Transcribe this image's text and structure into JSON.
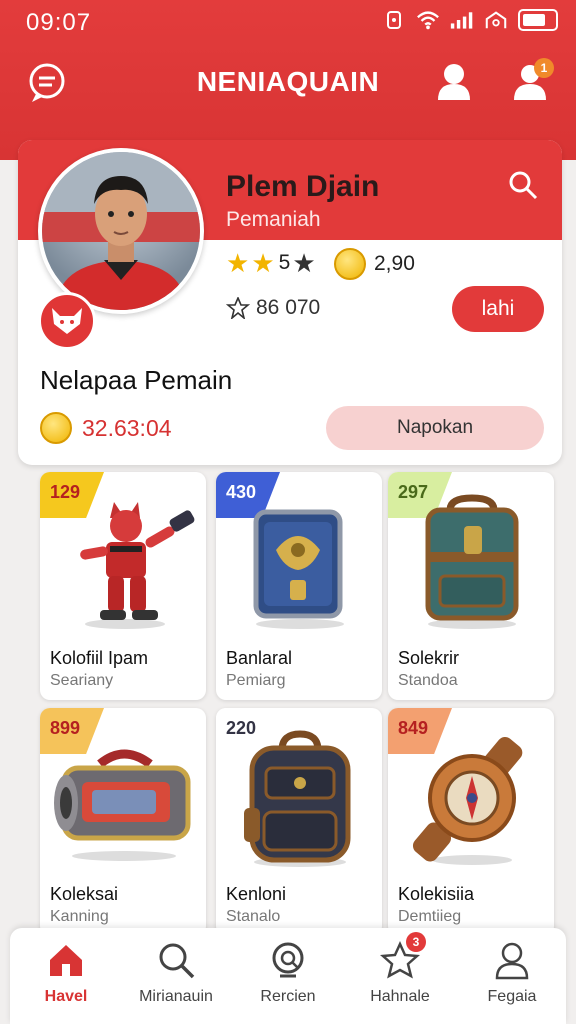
{
  "status_bar": {
    "time": "09:07"
  },
  "app_bar": {
    "title": "NENIAQUAIN",
    "profile_badge": "1"
  },
  "profile": {
    "name": "Plem Djain",
    "subtitle": "Pemaniah",
    "rating_text": "5",
    "coins": "2,90",
    "trophy_count": "86 070",
    "action_label": "lahi",
    "section_title": "Nelapaa Pemain",
    "balance": "32.63:04",
    "secondary_action_label": "Napokan"
  },
  "items": [
    {
      "tag": "129",
      "tag_color": "#f5c81e",
      "name": "Kolofiil Ipam",
      "sub": "Seariany",
      "icon": "mascot-figure-icon"
    },
    {
      "tag": "430",
      "tag_color": "#3f5fd6",
      "name": "Banlaral",
      "sub": "Pemiarg",
      "icon": "treasure-chest-icon"
    },
    {
      "tag": "297",
      "tag_color": "#d8eea0",
      "name": "Solekrir",
      "sub": "Standoa",
      "icon": "backpack-chest-icon"
    },
    {
      "tag": "899",
      "tag_color": "#f5c35a",
      "name": "Koleksai",
      "sub": "Kanning",
      "icon": "cannon-gadget-icon"
    },
    {
      "tag": "220",
      "tag_color": "#ffffff",
      "name": "Kenloni",
      "sub": "Stanalo",
      "icon": "leather-backpack-icon"
    },
    {
      "tag": "849",
      "tag_color": "#f3a070",
      "name": "Kolekisiia",
      "sub": "Demtiieg",
      "icon": "compass-gadget-icon"
    }
  ],
  "bottom_nav": [
    {
      "label": "Havel",
      "icon": "home-icon",
      "active": true
    },
    {
      "label": "Mirianauin",
      "icon": "search-icon",
      "active": false
    },
    {
      "label": "Rercien",
      "icon": "magnifier-badge-icon",
      "active": false
    },
    {
      "label": "Hahnale",
      "icon": "star-icon",
      "active": false,
      "badge": "3"
    },
    {
      "label": "Fegaia",
      "icon": "user-icon",
      "active": false
    }
  ],
  "colors": {
    "primary": "#e23a3a",
    "accent_gold": "#f2b400"
  }
}
